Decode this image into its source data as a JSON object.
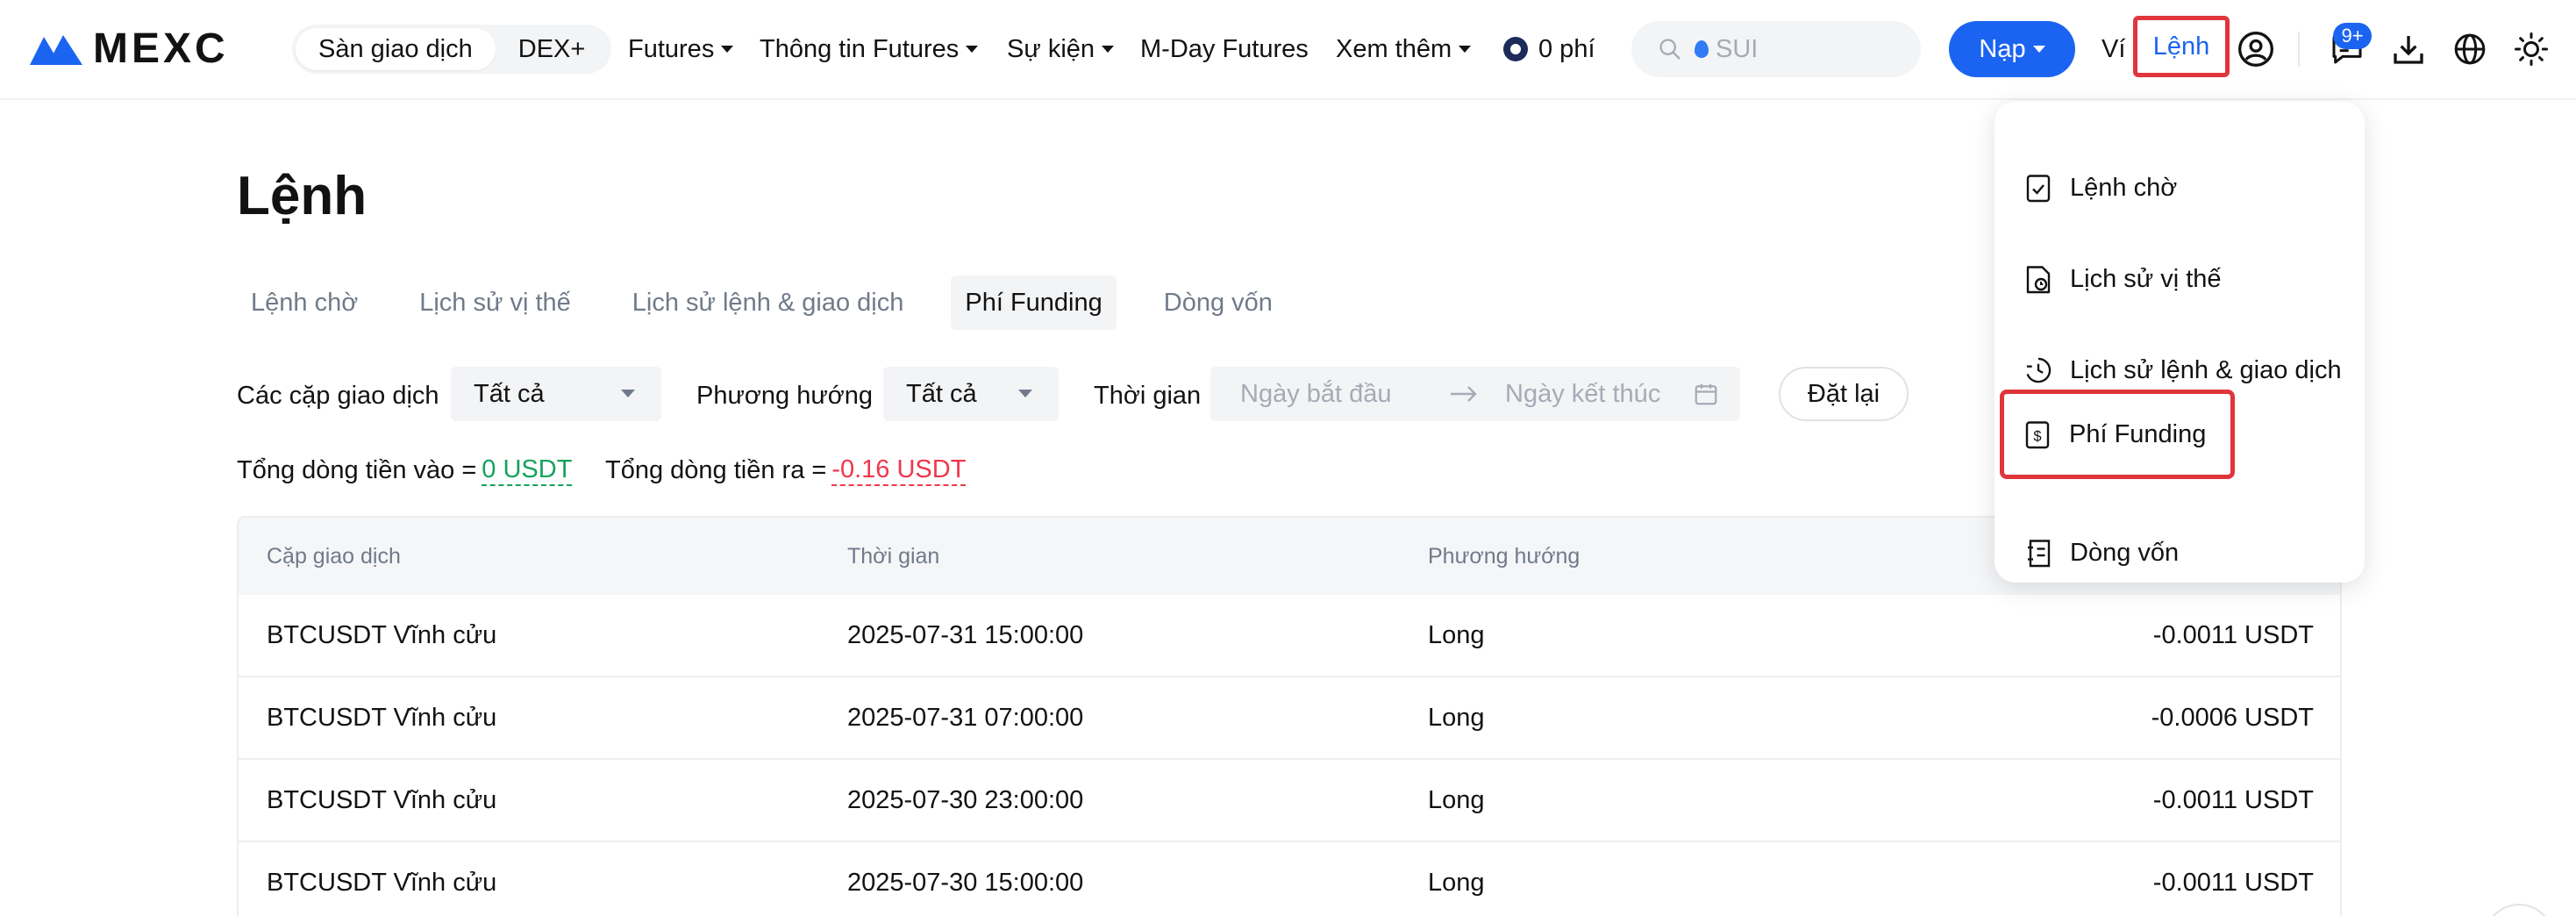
{
  "brand": {
    "name": "MEXC",
    "accent": "#1b64f2"
  },
  "nav": {
    "segments": [
      "Sàn giao dịch",
      "DEX+"
    ],
    "items": [
      {
        "label": "Futures",
        "has_caret": true
      },
      {
        "label": "Thông tin Futures",
        "has_caret": true
      },
      {
        "label": "Sự kiện",
        "has_caret": true
      },
      {
        "label": "M-Day Futures",
        "has_caret": false
      },
      {
        "label": "Xem thêm",
        "has_caret": true
      }
    ],
    "zero_fee_label": "0 phí",
    "search_placeholder": "SUI",
    "deposit_label": "Nạp",
    "wallet_label": "Ví",
    "orders_label": "Lệnh",
    "notification_badge": "9+",
    "icons": [
      "user-icon",
      "message-icon",
      "download-icon",
      "globe-icon",
      "sun-icon"
    ]
  },
  "page": {
    "title": "Lệnh",
    "tabs": [
      {
        "label": "Lệnh chờ",
        "active": false
      },
      {
        "label": "Lịch sử vị thế",
        "active": false
      },
      {
        "label": "Lịch sử lệnh & giao dịch",
        "active": false
      },
      {
        "label": "Phí Funding",
        "active": true
      },
      {
        "label": "Dòng vốn",
        "active": false
      }
    ]
  },
  "filters": {
    "pair_label": "Các cặp giao dịch",
    "pair_value": "Tất cả",
    "direction_label": "Phương hướng",
    "direction_value": "Tất cả",
    "time_label": "Thời gian",
    "start_placeholder": "Ngày bắt đầu",
    "end_placeholder": "Ngày kết thúc",
    "reset_label": "Đặt lại"
  },
  "summary": {
    "inflow_label": "Tổng dòng tiền vào =",
    "inflow_value": "0 USDT",
    "outflow_label": "Tổng dòng tiền ra =",
    "outflow_value": "-0.16 USDT"
  },
  "table": {
    "headers": [
      "Cặp giao dịch",
      "Thời gian",
      "Phương hướng"
    ],
    "rows": [
      {
        "pair": "BTCUSDT Vĩnh cửu",
        "time": "2025-07-31 15:00:00",
        "direction": "Long",
        "amount": "-0.0011 USDT"
      },
      {
        "pair": "BTCUSDT Vĩnh cửu",
        "time": "2025-07-31 07:00:00",
        "direction": "Long",
        "amount": "-0.0006 USDT"
      },
      {
        "pair": "BTCUSDT Vĩnh cửu",
        "time": "2025-07-30 23:00:00",
        "direction": "Long",
        "amount": "-0.0011 USDT"
      },
      {
        "pair": "BTCUSDT Vĩnh cửu",
        "time": "2025-07-30 15:00:00",
        "direction": "Long",
        "amount": "-0.0011 USDT"
      }
    ]
  },
  "orders_menu": {
    "items": [
      {
        "label": "Lệnh chờ",
        "icon": "clipboard-check-icon",
        "highlighted": false
      },
      {
        "label": "Lịch sử vị thế",
        "icon": "document-clock-icon",
        "highlighted": false
      },
      {
        "label": "Lịch sử lệnh & giao dịch",
        "icon": "clock-history-icon",
        "highlighted": false
      },
      {
        "label": "Phí Funding",
        "icon": "dollar-document-icon",
        "highlighted": true
      },
      {
        "label": "Dòng vốn",
        "icon": "ledger-icon",
        "highlighted": false
      }
    ]
  },
  "colors": {
    "positive": "#13a35c",
    "negative": "#f0364c",
    "highlight_border": "#e0353b"
  }
}
